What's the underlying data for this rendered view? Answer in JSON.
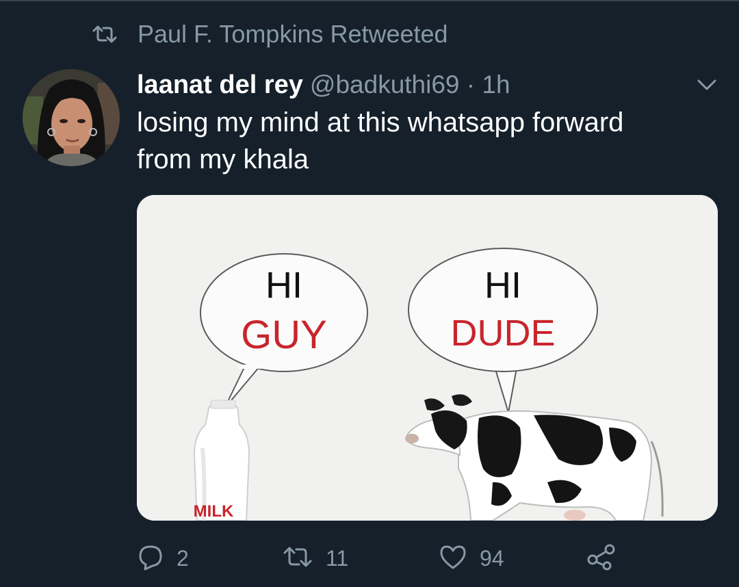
{
  "retweet_context": {
    "label": "Paul F. Tompkins Retweeted",
    "icon": "retweet-icon"
  },
  "tweet": {
    "author_name": "laanat del rey",
    "author_handle": "@badkuthi69 · 1h",
    "text_line1": "losing my mind at this whatsapp forward",
    "text_line2": "from my khala",
    "media": {
      "bubble_left_line1": "HI",
      "bubble_left_line2": "GUY",
      "bubble_right_line1": "HI",
      "bubble_right_line2": "DUDE",
      "bottle_label": "MILK"
    },
    "actions": {
      "replies": "2",
      "retweets": "11",
      "likes": "94"
    }
  },
  "colors": {
    "background": "#15202b",
    "secondary_text": "#8899a6",
    "meme_red": "#c8252c"
  }
}
